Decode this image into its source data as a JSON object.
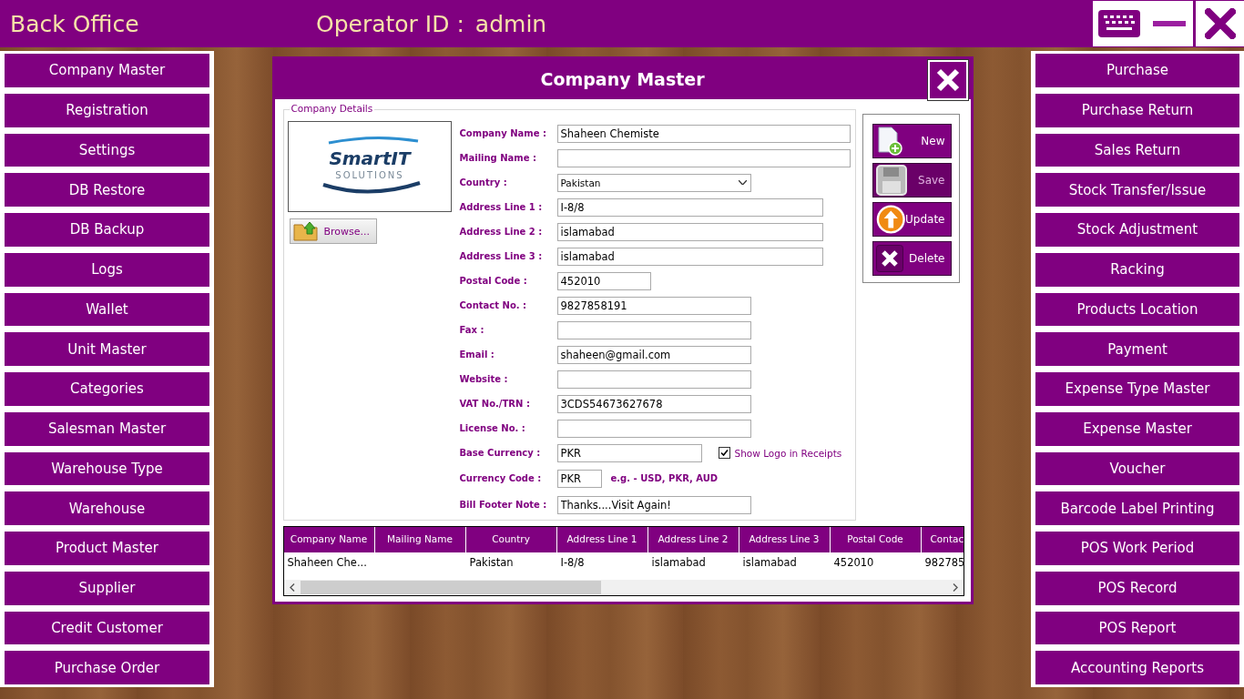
{
  "header": {
    "title": "Back Office",
    "operator_label": "Operator ID :",
    "operator": "admin"
  },
  "left_menu": [
    "Company Master",
    "Registration",
    "Settings",
    "DB Restore",
    "DB Backup",
    "Logs",
    "Wallet",
    "Unit Master",
    "Categories",
    "Salesman Master",
    "Warehouse Type",
    "Warehouse",
    "Product Master",
    "Supplier",
    "Credit Customer",
    "Purchase Order"
  ],
  "right_menu": [
    "Purchase",
    "Purchase Return",
    "Sales Return",
    "Stock Transfer/Issue",
    "Stock Adjustment",
    "Racking",
    "Products Location",
    "Payment",
    "Expense Type Master",
    "Expense Master",
    "Voucher",
    "Barcode Label Printing",
    "POS Work Period",
    "POS Record",
    "POS Report",
    "Accounting Reports"
  ],
  "dialog": {
    "title": "Company Master",
    "group_title": "Company Details",
    "logo": {
      "name": "SmartIT",
      "tagline": "SOLUTIONS"
    },
    "browse_button": "Browse...",
    "fields": [
      {
        "label": "Company Name :",
        "kind": "text",
        "value": "Shaheen Chemiste"
      },
      {
        "label": "Mailing Name :",
        "kind": "text"
      },
      {
        "label": "Country :",
        "kind": "select",
        "value": "Pakistan"
      },
      {
        "label": "Address Line 1 :",
        "kind": "text",
        "value": "I-8/8"
      },
      {
        "label": "Address Line 2 :",
        "kind": "text",
        "value": "islamabad"
      },
      {
        "label": "Address Line 3 :",
        "kind": "text",
        "value": "islamabad"
      },
      {
        "label": "Postal Code :",
        "kind": "text",
        "value": "452010"
      },
      {
        "label": "Contact No. :",
        "kind": "text",
        "value": "9827858191"
      },
      {
        "label": "Fax :",
        "kind": "text"
      },
      {
        "label": "Email :",
        "kind": "text",
        "value": "shaheen@gmail.com"
      },
      {
        "label": "Website :",
        "kind": "text"
      },
      {
        "label": "VAT No./TRN :",
        "kind": "text",
        "value": "3CDS54673627678"
      },
      {
        "label": "License No. :",
        "kind": "text"
      },
      {
        "label": "Base Currency :",
        "kind": "text",
        "value": "PKR",
        "checkbox": {
          "label": "Show Logo in Receipts",
          "checked": true
        }
      },
      {
        "label": "Currency Code :",
        "kind": "text",
        "value": "PKR",
        "hint": "e.g. - USD, PKR, AUD"
      },
      {
        "label": "Bill Footer Note :",
        "kind": "text",
        "value": "Thanks....Visit Again!"
      }
    ],
    "actions": [
      {
        "kind": "new",
        "label": "New",
        "disabled": false
      },
      {
        "kind": "save",
        "label": "Save",
        "disabled": true
      },
      {
        "kind": "update",
        "label": "Update",
        "disabled": false
      },
      {
        "kind": "delete",
        "label": "Delete",
        "disabled": false
      }
    ],
    "table": {
      "columns": [
        "Company Name",
        "Mailing Name",
        "Country",
        "Address Line 1",
        "Address Line 2",
        "Address Line 3",
        "Postal Code",
        "Contac"
      ],
      "rows": [
        [
          "Shaheen Che...",
          "",
          "Pakistan",
          "I-8/8",
          "islamabad",
          "islamabad",
          "452010",
          "982785"
        ]
      ]
    }
  }
}
